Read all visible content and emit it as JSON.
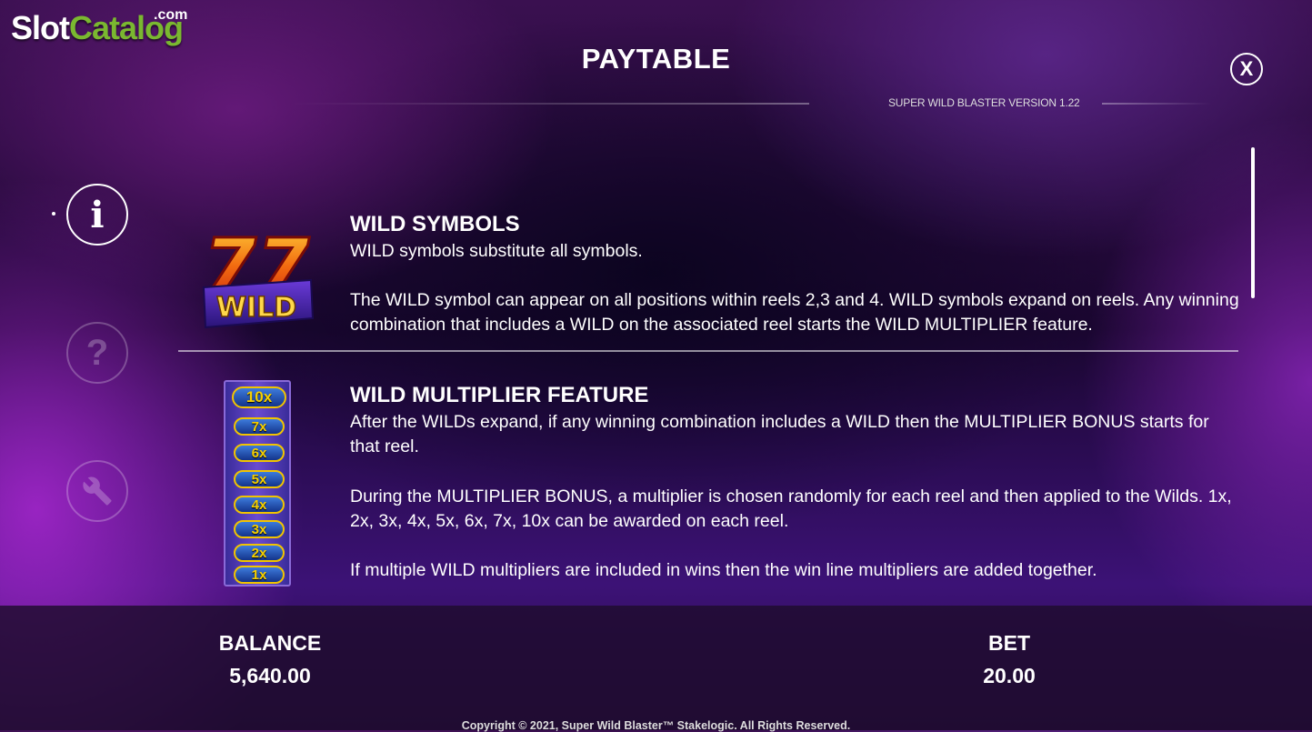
{
  "logo": {
    "slot": "Slot",
    "catalog": "Catalog",
    "com": ".com"
  },
  "header": {
    "title": "PAYTABLE",
    "version": "SUPER WILD BLASTER VERSION 1.22",
    "close_label": "X"
  },
  "side_menu": {
    "info_label": "i",
    "help_label": "?"
  },
  "sections": [
    {
      "title": "WILD SYMBOLS",
      "paragraphs": [
        "WILD symbols substitute all symbols.",
        "The WILD symbol can appear on all positions within reels 2,3 and 4. WILD symbols expand on reels. Any winning combination that includes a WILD on the associated reel starts the WILD MULTIPLIER feature."
      ],
      "icon_text": {
        "number": "77",
        "word": "WILD"
      }
    },
    {
      "title": "WILD MULTIPLIER FEATURE",
      "paragraphs": [
        "After the WILDs expand, if any winning combination includes a WILD then the MULTIPLIER BONUS starts for that reel.",
        "During the MULTIPLIER BONUS, a multiplier is chosen randomly for each reel and then applied to the Wilds. 1x, 2x, 3x, 4x, 5x, 6x, 7x, 10x can be awarded on each reel.",
        "If multiple WILD multipliers are included in wins then the win line multipliers are added together."
      ],
      "multipliers": [
        "10x",
        "7x",
        "6x",
        "5x",
        "4x",
        "3x",
        "2x",
        "1x"
      ]
    }
  ],
  "footer": {
    "balance_label": "BALANCE",
    "balance_value": "5,640.00",
    "bet_label": "BET",
    "bet_value": "20.00",
    "copyright": "Copyright © 2021, Super Wild Blaster™ Stakelogic. All Rights Reserved."
  },
  "colors": {
    "accent_green": "#7ab830",
    "multiplier_gold": "#f6d000",
    "wild_red": "#e8321a"
  }
}
